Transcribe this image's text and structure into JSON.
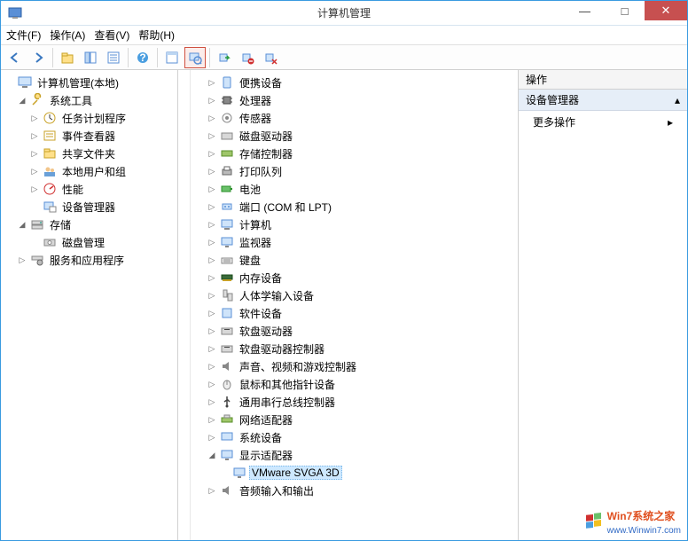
{
  "window": {
    "title": "计算机管理",
    "minimize": "—",
    "maximize": "□",
    "close": "✕"
  },
  "menu": {
    "file": "文件(F)",
    "action": "操作(A)",
    "view": "查看(V)",
    "help": "帮助(H)"
  },
  "toolbar_icons": {
    "back": "back-icon",
    "forward": "forward-icon",
    "up": "up-icon",
    "show": "show-icon",
    "list": "list-icon",
    "help": "help-icon",
    "prop": "properties-icon",
    "scan": "scan-hardware-icon",
    "enable": "enable-icon",
    "disable": "disable-icon",
    "uninstall": "uninstall-icon"
  },
  "nav": {
    "root": "计算机管理(本地)",
    "systools": "系统工具",
    "taskscheduler": "任务计划程序",
    "eventviewer": "事件查看器",
    "sharedfolders": "共享文件夹",
    "localusers": "本地用户和组",
    "performance": "性能",
    "devicemanager": "设备管理器",
    "storage": "存储",
    "diskmgmt": "磁盘管理",
    "services": "服务和应用程序"
  },
  "devices": {
    "portable": "便携设备",
    "processors": "处理器",
    "sensors": "传感器",
    "diskdrives": "磁盘驱动器",
    "storagectrl": "存储控制器",
    "printqueues": "打印队列",
    "batteries": "电池",
    "ports": "端口 (COM 和 LPT)",
    "computer": "计算机",
    "monitors": "监视器",
    "keyboards": "键盘",
    "memory": "内存设备",
    "hid": "人体学输入设备",
    "software": "软件设备",
    "floppy": "软盘驱动器",
    "floppyctrl": "软盘驱动器控制器",
    "sound": "声音、视频和游戏控制器",
    "mice": "鼠标和其他指针设备",
    "usb": "通用串行总线控制器",
    "network": "网络适配器",
    "system": "系统设备",
    "display": "显示适配器",
    "display_child": "VMware SVGA 3D",
    "audioio": "音频输入和输出"
  },
  "actions": {
    "header": "操作",
    "section": "设备管理器",
    "more": "更多操作"
  },
  "glyphs": {
    "collapsed": "▷",
    "expanded": "◢",
    "caret_up": "▴",
    "caret_right": "▸"
  },
  "watermark": {
    "brand": "Win7系统之家",
    "url": "www.Winwin7.com"
  }
}
